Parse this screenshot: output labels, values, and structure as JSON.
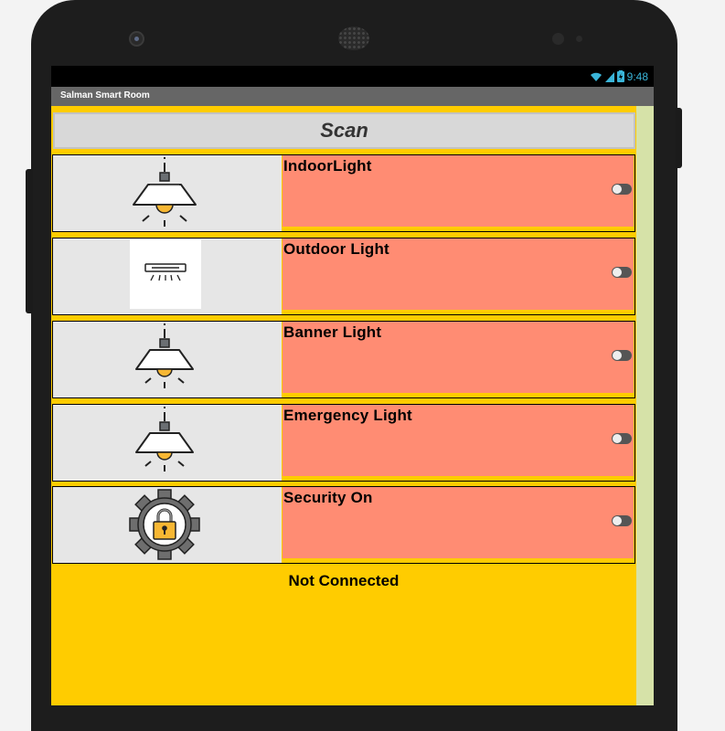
{
  "status_bar": {
    "time": "9:48"
  },
  "app": {
    "title": "Salman Smart Room"
  },
  "scan_button": {
    "label": "Scan"
  },
  "devices": [
    {
      "label": "IndoorLight",
      "icon": "pendant-lamp-icon",
      "switch_on": false
    },
    {
      "label": "Outdoor Light",
      "icon": "wall-light-icon",
      "switch_on": false
    },
    {
      "label": "Banner Light",
      "icon": "pendant-lamp-icon",
      "switch_on": false
    },
    {
      "label": "Emergency Light",
      "icon": "pendant-lamp-icon",
      "switch_on": false
    },
    {
      "label": "Security On",
      "icon": "lock-gear-icon",
      "switch_on": false
    }
  ],
  "connection_status": {
    "text": "Not Connected"
  },
  "colors": {
    "background": "#ffcc00",
    "panel": "#ff8c73",
    "icon_cell": "#e6e6e6",
    "scan_button": "#d8d8d8"
  }
}
